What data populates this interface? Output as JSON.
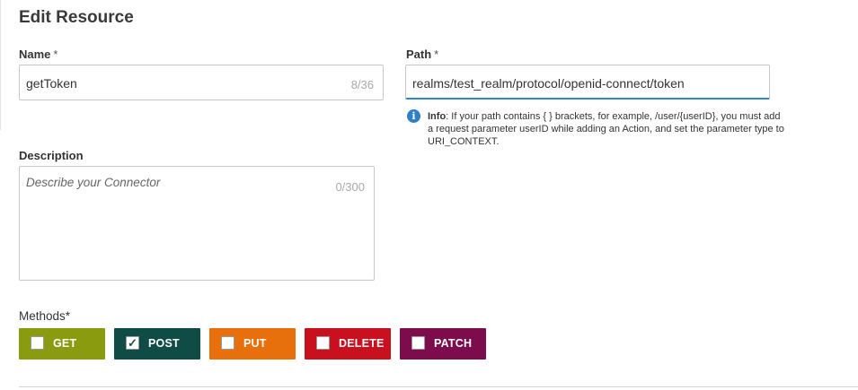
{
  "title": "Edit Resource",
  "name_field": {
    "label": "Name",
    "required_mark": "*",
    "value": "getToken",
    "counter": "8/36"
  },
  "path_field": {
    "label": "Path",
    "required_mark": "*",
    "value": "realms/test_realm/protocol/openid-connect/token"
  },
  "info": {
    "icon": "info-icon",
    "bold": "Info",
    "text": ": If your path contains { } brackets, for example, /user/{userID}, you must add a request parameter userID while adding an Action, and set the parameter type to URI_CONTEXT."
  },
  "description_field": {
    "label": "Description",
    "placeholder": "Describe your Connector",
    "counter": "0/300"
  },
  "methods": {
    "label": "Methods*",
    "items": [
      {
        "label": "GET",
        "checked": false,
        "color": "#8a9b0f"
      },
      {
        "label": "POST",
        "checked": true,
        "color": "#0f4c45"
      },
      {
        "label": "PUT",
        "checked": false,
        "color": "#e8700c"
      },
      {
        "label": "DELETE",
        "checked": false,
        "color": "#c8101e"
      },
      {
        "label": "PATCH",
        "checked": false,
        "color": "#7c0c4c"
      }
    ]
  }
}
